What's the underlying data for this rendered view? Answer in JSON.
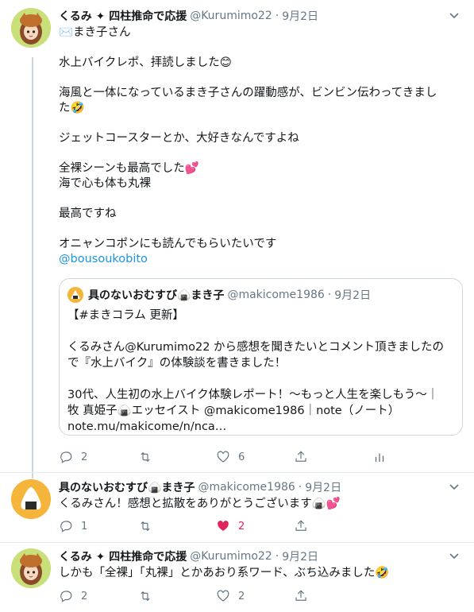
{
  "tweet1": {
    "name": "くるみ ✦ 四柱推命で応援",
    "handle": "@Kurumimo22",
    "dot": "·",
    "date": "9月2日",
    "lines": {
      "l1": "✉️まき子さん",
      "l2": "水上バイクレポ、拝読しました😊",
      "l3": "海風と一体になっているまき子さんの躍動感が、ビンビン伝わってきまし",
      "l4": "た🤣",
      "l5": "ジェットコースターとか、大好きなんですよね",
      "l6": "全裸シーンも最高でした💕",
      "l7": "海で心も体も丸裸",
      "l8": "最高ですね",
      "l9": "オニャンコポンにも読んでもらいたいです",
      "l10": "@bousoukobito"
    },
    "quote": {
      "name": "具のないおむすび🍙まき子",
      "handle": "@makicome1986",
      "dot": "·",
      "date": "9月2日",
      "lines": {
        "q1": "【#まきコラム 更新】",
        "q2": "くるみさん@Kurumimo22 から感想を聞きたいとコメント頂きましたの",
        "q3": "で『水上バイク』の体験談を書きました！",
        "q4": "30代、人生初の水上バイク体験レポート！〜もっと人生を楽しもう〜｜",
        "q5": "牧 真姫子🍙エッセイスト @makicome1986｜note（ノート）",
        "q6": "note.mu/makicome/n/nca…"
      }
    },
    "counts": {
      "reply": "2",
      "retweet": "",
      "like": "6"
    }
  },
  "tweet2": {
    "name": "具のないおむすび🍙まき子",
    "handle": "@makicome1986",
    "dot": "·",
    "date": "9月2日",
    "text": "くるみさん！感想と拡散をありがとうございます🍙💕",
    "counts": {
      "reply": "1",
      "retweet": "",
      "like": "2"
    }
  },
  "tweet3": {
    "name": "くるみ ✦ 四柱推命で応援",
    "handle": "@Kurumimo22",
    "dot": "·",
    "date": "9月2日",
    "text": "しかも「全裸」「丸裸」とかあおり系ワード、ぶち込みました🤣",
    "counts": {
      "reply": "2",
      "retweet": "",
      "like": "2"
    }
  },
  "colors": {
    "link": "#1b95e0",
    "like_active": "#e0245e",
    "secondary": "#657786",
    "thread": "#ccd6dd"
  },
  "icons": [
    "reply-icon",
    "retweet-icon",
    "like-icon",
    "share-icon",
    "analytics-icon",
    "chevron-down-icon"
  ]
}
